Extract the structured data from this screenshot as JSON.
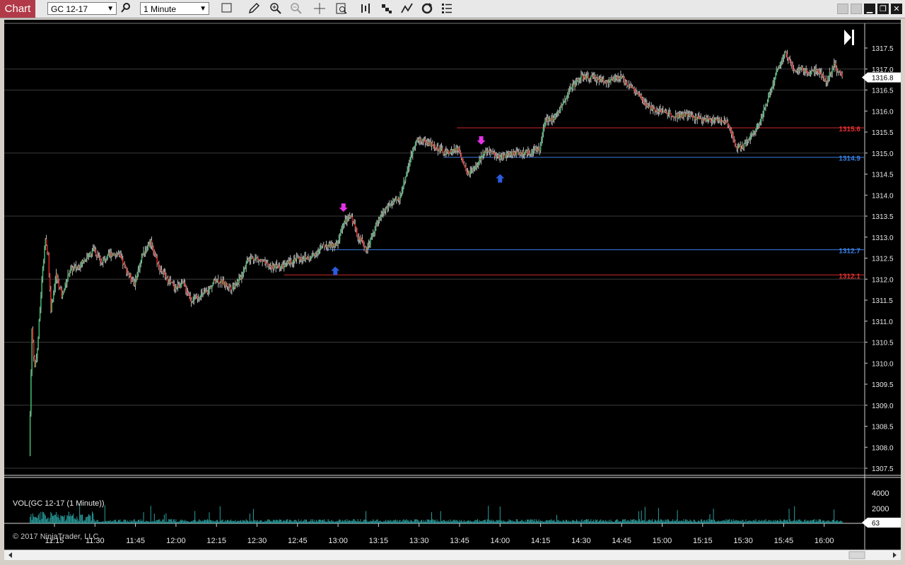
{
  "toolbar": {
    "chart_tab": "Chart",
    "instrument": "GC 12-17",
    "interval": "1 Minute"
  },
  "chart": {
    "current_price": "1316.8",
    "volume_label": "VOL(GC 12-17 (1 Minute))",
    "volume_current": "63",
    "copyright": "© 2017 NinjaTrader, LLC",
    "lines": [
      {
        "label": "1315.6",
        "color": "#e03030"
      },
      {
        "label": "1314.9",
        "color": "#3a7de0"
      },
      {
        "label": "1312.7",
        "color": "#3a7de0"
      },
      {
        "label": "1312.1",
        "color": "#e03030"
      }
    ]
  },
  "chart_data": {
    "type": "candlestick",
    "instrument": "GC 12-17",
    "interval": "1 Minute",
    "price_ticks": [
      "1317.5",
      "1317.0",
      "1316.5",
      "1316.0",
      "1315.5",
      "1315.0",
      "1314.5",
      "1314.0",
      "1313.5",
      "1313.0",
      "1312.5",
      "1312.0",
      "1311.5",
      "1311.0",
      "1310.5",
      "1310.0",
      "1309.5",
      "1309.0",
      "1308.5",
      "1308.0",
      "1307.5"
    ],
    "time_ticks": [
      "11:15",
      "11:30",
      "11:45",
      "12:00",
      "12:15",
      "12:30",
      "12:45",
      "13:00",
      "13:15",
      "13:30",
      "13:45",
      "14:00",
      "14:15",
      "14:30",
      "14:45",
      "15:00",
      "15:15",
      "15:30",
      "15:45",
      "16:00"
    ],
    "volume_ticks": [
      "4000",
      "2000"
    ],
    "current_price": 1316.8,
    "volume_current": 63,
    "price_path": [
      [
        "11:06",
        1307.8
      ],
      [
        "11:07",
        1310.8
      ],
      [
        "11:08",
        1309.9
      ],
      [
        "11:09",
        1310.3
      ],
      [
        "11:10",
        1311.3
      ],
      [
        "11:11",
        1312.3
      ],
      [
        "11:12",
        1312.9
      ],
      [
        "11:13",
        1312.6
      ],
      [
        "11:14",
        1311.3
      ],
      [
        "11:16",
        1312.1
      ],
      [
        "11:18",
        1311.6
      ],
      [
        "11:21",
        1312.2
      ],
      [
        "11:24",
        1312.3
      ],
      [
        "11:27",
        1312.5
      ],
      [
        "11:30",
        1312.7
      ],
      [
        "11:33",
        1312.4
      ],
      [
        "11:36",
        1312.6
      ],
      [
        "11:39",
        1312.6
      ],
      [
        "11:42",
        1312.2
      ],
      [
        "11:45",
        1311.9
      ],
      [
        "11:48",
        1312.6
      ],
      [
        "11:51",
        1312.9
      ],
      [
        "11:54",
        1312.3
      ],
      [
        "11:57",
        1312.0
      ],
      [
        "12:00",
        1311.8
      ],
      [
        "12:03",
        1311.9
      ],
      [
        "12:06",
        1311.5
      ],
      [
        "12:09",
        1311.6
      ],
      [
        "12:12",
        1311.7
      ],
      [
        "12:15",
        1312.0
      ],
      [
        "12:18",
        1311.9
      ],
      [
        "12:21",
        1311.8
      ],
      [
        "12:24",
        1312.0
      ],
      [
        "12:27",
        1312.5
      ],
      [
        "12:30",
        1312.5
      ],
      [
        "12:35",
        1312.3
      ],
      [
        "12:40",
        1312.3
      ],
      [
        "12:45",
        1312.5
      ],
      [
        "12:50",
        1312.5
      ],
      [
        "12:55",
        1312.8
      ],
      [
        "13:00",
        1312.8
      ],
      [
        "13:02",
        1313.3
      ],
      [
        "13:05",
        1313.5
      ],
      [
        "13:08",
        1313.0
      ],
      [
        "13:11",
        1312.7
      ],
      [
        "13:14",
        1313.2
      ],
      [
        "13:17",
        1313.6
      ],
      [
        "13:20",
        1313.8
      ],
      [
        "13:23",
        1313.9
      ],
      [
        "13:26",
        1314.6
      ],
      [
        "13:29",
        1315.3
      ],
      [
        "13:32",
        1315.3
      ],
      [
        "13:35",
        1315.2
      ],
      [
        "13:40",
        1315.0
      ],
      [
        "13:45",
        1315.1
      ],
      [
        "13:48",
        1314.5
      ],
      [
        "13:51",
        1314.6
      ],
      [
        "13:54",
        1315.0
      ],
      [
        "13:57",
        1315.0
      ],
      [
        "14:00",
        1314.9
      ],
      [
        "14:05",
        1315.0
      ],
      [
        "14:10",
        1315.0
      ],
      [
        "14:15",
        1315.1
      ],
      [
        "14:17",
        1315.8
      ],
      [
        "14:20",
        1315.8
      ],
      [
        "14:23",
        1316.1
      ],
      [
        "14:26",
        1316.5
      ],
      [
        "14:30",
        1316.8
      ],
      [
        "14:35",
        1316.8
      ],
      [
        "14:40",
        1316.7
      ],
      [
        "14:45",
        1316.8
      ],
      [
        "14:50",
        1316.5
      ],
      [
        "14:55",
        1316.1
      ],
      [
        "15:00",
        1316.0
      ],
      [
        "15:05",
        1315.9
      ],
      [
        "15:10",
        1315.9
      ],
      [
        "15:15",
        1315.8
      ],
      [
        "15:20",
        1315.8
      ],
      [
        "15:25",
        1315.7
      ],
      [
        "15:28",
        1315.1
      ],
      [
        "15:31",
        1315.2
      ],
      [
        "15:34",
        1315.5
      ],
      [
        "15:37",
        1315.8
      ],
      [
        "15:40",
        1316.4
      ],
      [
        "15:43",
        1317.0
      ],
      [
        "15:46",
        1317.4
      ],
      [
        "15:49",
        1317.0
      ],
      [
        "15:52",
        1317.0
      ],
      [
        "15:55",
        1316.9
      ],
      [
        "15:58",
        1317.0
      ],
      [
        "16:01",
        1316.7
      ],
      [
        "16:04",
        1317.1
      ],
      [
        "16:07",
        1316.8
      ]
    ],
    "horizontal_lines": [
      {
        "price": 1315.6,
        "color": "red",
        "start": "13:44"
      },
      {
        "price": 1314.9,
        "color": "blue",
        "start": "13:39"
      },
      {
        "price": 1312.7,
        "color": "blue",
        "start": "12:56"
      },
      {
        "price": 1312.1,
        "color": "red",
        "start": "12:40"
      }
    ],
    "markers": [
      {
        "type": "down-arrow",
        "color": "magenta",
        "time": "13:02",
        "price": 1313.6
      },
      {
        "type": "down-arrow",
        "color": "magenta",
        "time": "13:53",
        "price": 1315.2
      },
      {
        "type": "up-arrow",
        "color": "blue",
        "time": "12:59",
        "price": 1312.3
      },
      {
        "type": "up-arrow",
        "color": "blue",
        "time": "14:00",
        "price": 1314.5
      }
    ]
  }
}
